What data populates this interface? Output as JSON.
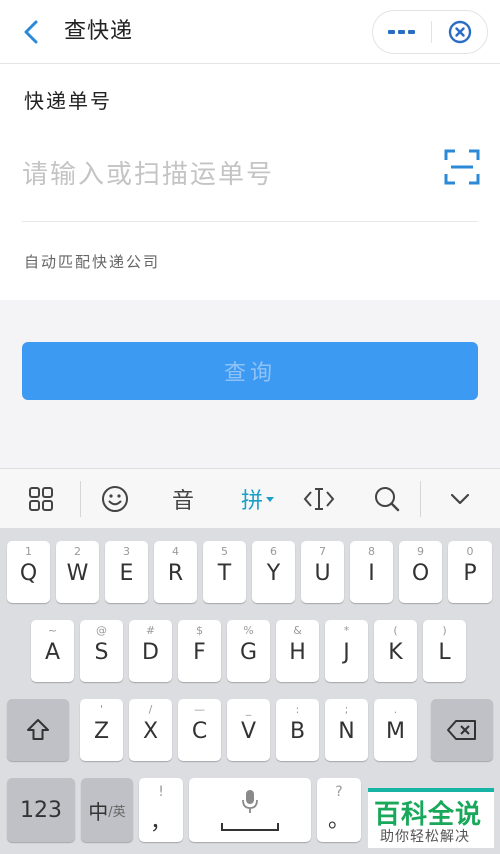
{
  "header": {
    "title": "查快递",
    "back_icon": "chevron-left-icon",
    "more_icon": "more-dots-icon",
    "close_icon": "target-close-icon",
    "accent": "#2a8ad8"
  },
  "form": {
    "label": "快递单号",
    "input_placeholder": "请输入或扫描运单号",
    "input_value": "",
    "scan_icon": "scan-icon",
    "auto_match": "自动匹配快递公司"
  },
  "query_button": {
    "label": "查询",
    "color": "#3d9af3"
  },
  "keyboard_toolbar": {
    "grid_icon": "grid-icon",
    "emoji_icon": "emoji-icon",
    "voice_label": "音",
    "mode_label": "拼",
    "mode_color": "#1aa0c8",
    "cursor_icon": "cursor-move-icon",
    "search_icon": "search-icon",
    "collapse_icon": "chevron-down-icon"
  },
  "keyboard": {
    "row1": [
      {
        "sub": "1",
        "main": "Q"
      },
      {
        "sub": "2",
        "main": "W"
      },
      {
        "sub": "3",
        "main": "E"
      },
      {
        "sub": "4",
        "main": "R"
      },
      {
        "sub": "5",
        "main": "T"
      },
      {
        "sub": "6",
        "main": "Y"
      },
      {
        "sub": "7",
        "main": "U"
      },
      {
        "sub": "8",
        "main": "I"
      },
      {
        "sub": "9",
        "main": "O"
      },
      {
        "sub": "0",
        "main": "P"
      }
    ],
    "row2": [
      {
        "sub": "~",
        "main": "A"
      },
      {
        "sub": "@",
        "main": "S"
      },
      {
        "sub": "#",
        "main": "D"
      },
      {
        "sub": "$",
        "main": "F"
      },
      {
        "sub": "%",
        "main": "G"
      },
      {
        "sub": "&",
        "main": "H"
      },
      {
        "sub": "*",
        "main": "J"
      },
      {
        "sub": "(",
        "main": "K"
      },
      {
        "sub": ")",
        "main": "L"
      }
    ],
    "row3": [
      {
        "sub": "'",
        "main": "Z"
      },
      {
        "sub": "/",
        "main": "X"
      },
      {
        "sub": "—",
        "main": "C"
      },
      {
        "sub": "_",
        "main": "V"
      },
      {
        "sub": ":",
        "main": "B"
      },
      {
        "sub": ";",
        "main": "N"
      },
      {
        "sub": ".",
        "main": "M"
      }
    ],
    "shift_icon": "shift-icon",
    "backspace_icon": "backspace-icon",
    "num_label": "123",
    "lang_main": "中",
    "lang_sub": "/英",
    "comma_sub": "!",
    "comma_main": "，",
    "space_icon": "microphone-icon",
    "period_sub": "?",
    "period_main": "。"
  },
  "watermark": {
    "big": "百科全说",
    "small": "助你轻松解决"
  }
}
